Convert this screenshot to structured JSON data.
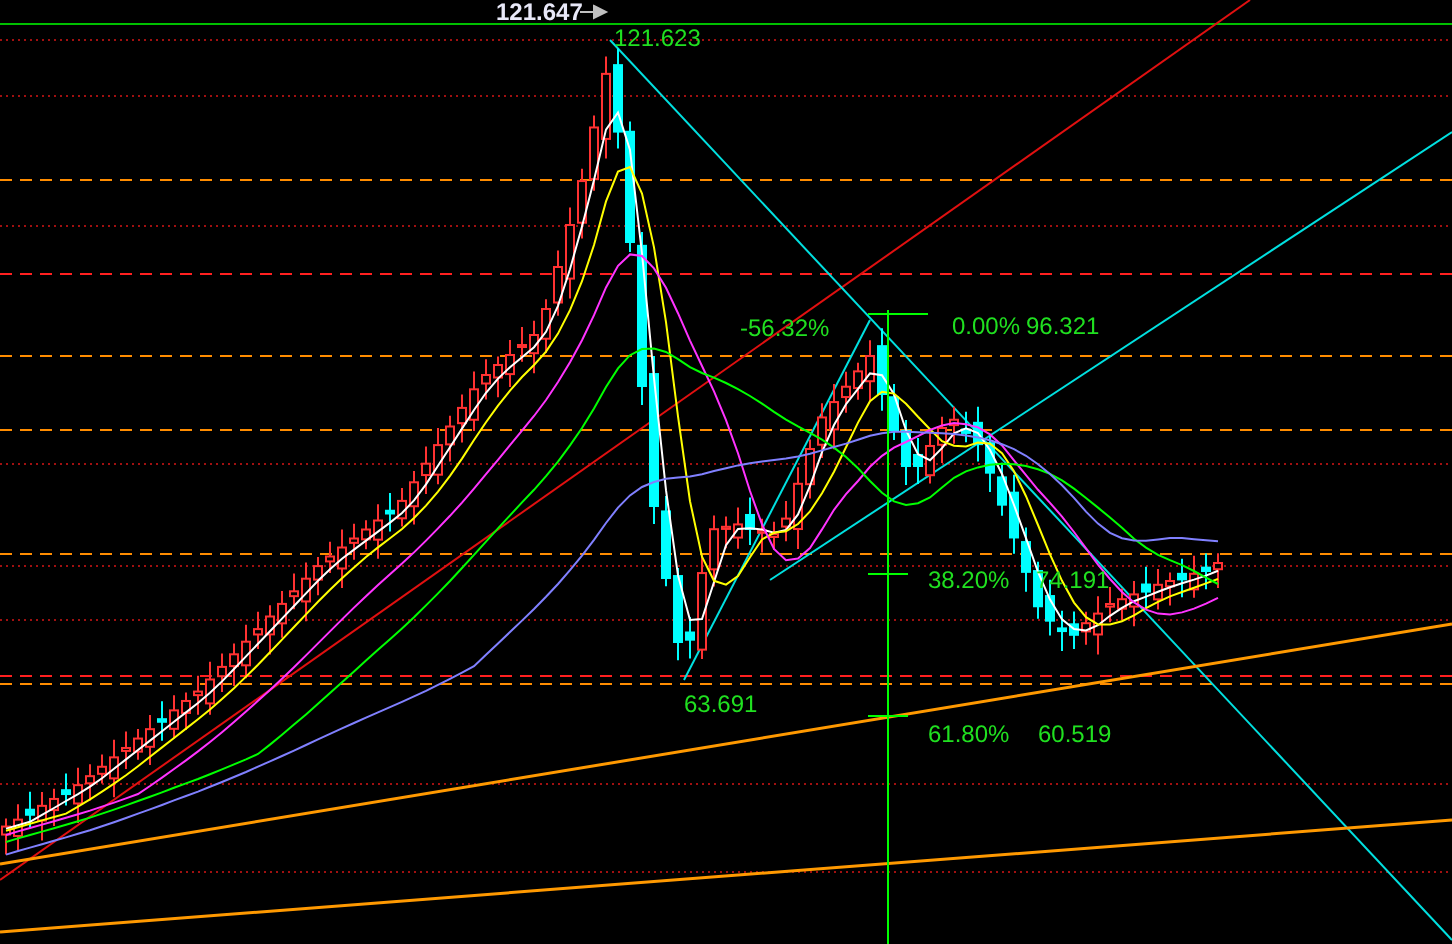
{
  "chart": {
    "labels": [
      {
        "kind": "flag",
        "text": "121.647"
      },
      {
        "kind": "level",
        "text": "121.623"
      },
      {
        "kind": "level",
        "text": "-56.32%"
      },
      {
        "kind": "level",
        "text": "0.00%"
      },
      {
        "kind": "level",
        "text": "96.321"
      },
      {
        "kind": "level",
        "text": "38.20%"
      },
      {
        "kind": "level",
        "text": "74.191"
      },
      {
        "kind": "level",
        "text": "63.691"
      },
      {
        "kind": "level",
        "text": "61.80%"
      },
      {
        "kind": "level",
        "text": "60.519"
      }
    ]
  }
}
